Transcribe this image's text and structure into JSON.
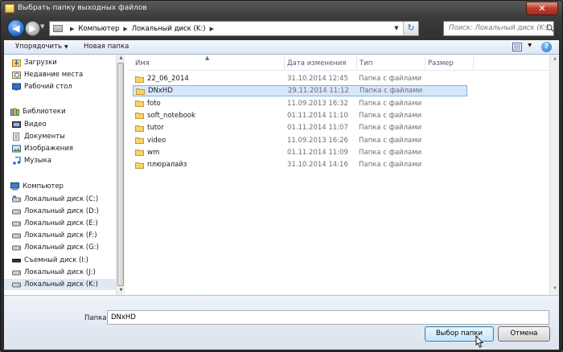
{
  "window": {
    "title": "Выбрать папку выходных файлов",
    "close_label": "✕"
  },
  "address_bar": {
    "parts": [
      "Компьютер",
      "Локальный диск (K:)"
    ]
  },
  "search": {
    "placeholder": "Поиск: Локальный диск (K:)"
  },
  "toolbar": {
    "organize_label": "Упорядочить",
    "new_folder_label": "Новая папка"
  },
  "nav": {
    "favorites": [
      {
        "label": "Загрузки",
        "icon": "downloads-folder-icon"
      },
      {
        "label": "Недавние места",
        "icon": "recent-places-icon"
      },
      {
        "label": "Рабочий стол",
        "icon": "desktop-icon"
      }
    ],
    "libraries_label": "Библиотеки",
    "libraries": [
      {
        "label": "Видео",
        "icon": "video-library-icon"
      },
      {
        "label": "Документы",
        "icon": "documents-library-icon"
      },
      {
        "label": "Изображения",
        "icon": "pictures-library-icon"
      },
      {
        "label": "Музыка",
        "icon": "music-library-icon"
      }
    ],
    "computer_label": "Компьютер",
    "drives": [
      {
        "label": "Локальный диск (C:)"
      },
      {
        "label": "Локальный диск (D:)"
      },
      {
        "label": "Локальный диск (E:)"
      },
      {
        "label": "Локальный диск (F:)"
      },
      {
        "label": "Локальный диск (G:)"
      },
      {
        "label": "Съемный диск (I:)"
      },
      {
        "label": "Локальный диск (J:)"
      },
      {
        "label": "Локальный диск (K:)"
      }
    ],
    "selected_drive": "Локальный диск (K:)"
  },
  "columns": {
    "name": "Имя",
    "date": "Дата изменения",
    "type": "Тип",
    "size": "Размер"
  },
  "files": [
    {
      "name": "22_06_2014",
      "date": "31.10.2014 12:45",
      "type": "Папка с файлами"
    },
    {
      "name": "DNxHD",
      "date": "29.11.2014 11:12",
      "type": "Папка с файлами"
    },
    {
      "name": "foto",
      "date": "11.09.2013 16:32",
      "type": "Папка с файлами"
    },
    {
      "name": "soft_notebook",
      "date": "01.11.2014 11:10",
      "type": "Папка с файлами"
    },
    {
      "name": "tutor",
      "date": "01.11.2014 11:07",
      "type": "Папка с файлами"
    },
    {
      "name": "video",
      "date": "11.09.2013 16:26",
      "type": "Папка с файлами"
    },
    {
      "name": "wm",
      "date": "01.11.2014 11:09",
      "type": "Папка с файлами"
    },
    {
      "name": "плюралайз",
      "date": "31.10.2014 14:16",
      "type": "Папка с файлами"
    }
  ],
  "selected_file": "DNxHD",
  "footer": {
    "folder_label": "Папка:",
    "folder_value": "DNxHD",
    "select_label": "Выбор папки",
    "cancel_label": "Отмена"
  }
}
